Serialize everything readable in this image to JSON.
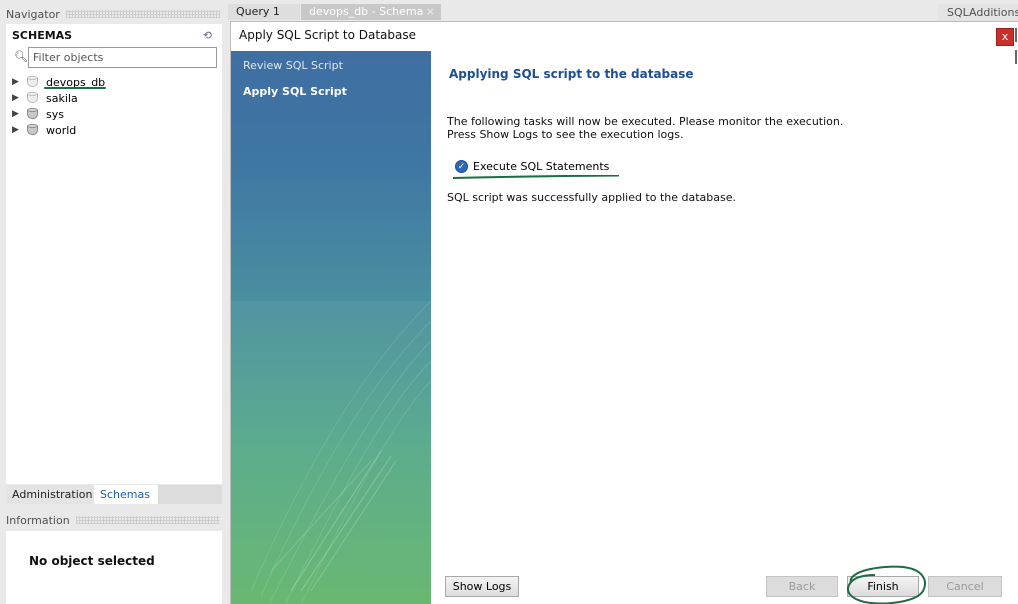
{
  "navigator": {
    "header": "Navigator",
    "schemas_title": "SCHEMAS",
    "refresh_icon": "refresh-icon",
    "filter_placeholder": "Filter objects",
    "schemas": [
      {
        "name": "devops_db"
      },
      {
        "name": "sakila"
      },
      {
        "name": "sys"
      },
      {
        "name": "world"
      }
    ],
    "tabs": {
      "administration": "Administration",
      "schemas": "Schemas"
    },
    "info_header": "Information",
    "info_text": "No object selected"
  },
  "editor_tabs": {
    "query": "Query 1",
    "schema": "devops_db - Schema",
    "close_symbol": "×",
    "sql_additions": "SQLAdditions"
  },
  "dialog": {
    "title": "Apply SQL Script to Database",
    "close_symbol": "x",
    "steps": {
      "review": "Review SQL Script",
      "apply": "Apply SQL Script"
    },
    "main_title": "Applying SQL script to the database",
    "desc_line1": "The following tasks will now be executed. Please monitor the execution.",
    "desc_line2": "Press Show Logs to see the execution logs.",
    "task_label": "Execute SQL Statements",
    "result": "SQL script was successfully applied to the database.",
    "buttons": {
      "show_logs": "Show Logs",
      "back": "Back",
      "finish": "Finish",
      "cancel": "Cancel"
    }
  },
  "colors": {
    "accent_title": "#1e4f93",
    "annotation_green": "#1e6b45",
    "close_red": "#c9302c"
  }
}
